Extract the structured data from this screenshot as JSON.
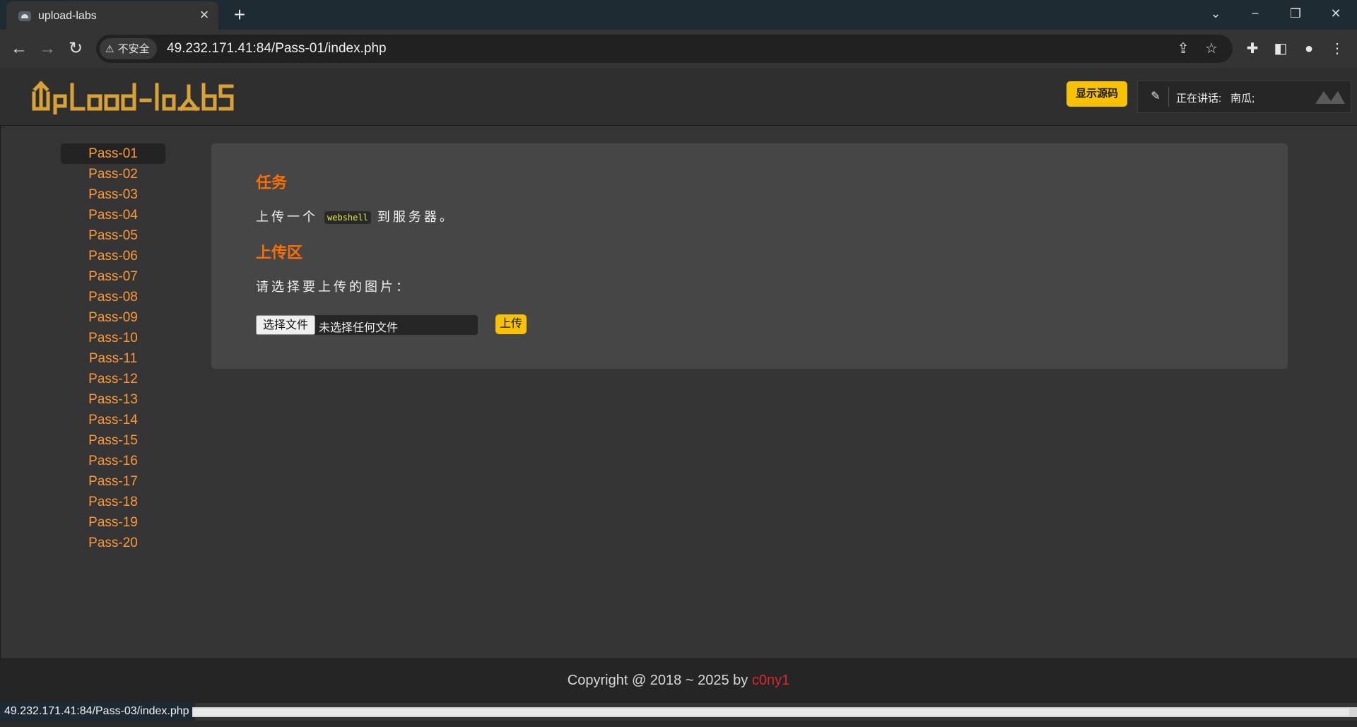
{
  "browser": {
    "tab_title": "upload-labs",
    "security_label": "不安全",
    "url": "49.232.171.41:84/Pass-01/index.php",
    "status_url": "49.232.171.41:84/Pass-03/index.php"
  },
  "header": {
    "logo_text": "Upload-labS",
    "source_button": "显示源码",
    "voice_speaking": "正在讲话:",
    "voice_speaker": "南瓜;"
  },
  "sidebar": {
    "items": [
      "Pass-01",
      "Pass-02",
      "Pass-03",
      "Pass-04",
      "Pass-05",
      "Pass-06",
      "Pass-07",
      "Pass-08",
      "Pass-09",
      "Pass-10",
      "Pass-11",
      "Pass-12",
      "Pass-13",
      "Pass-14",
      "Pass-15",
      "Pass-16",
      "Pass-17",
      "Pass-18",
      "Pass-19",
      "Pass-20"
    ],
    "active_index": 0
  },
  "task": {
    "heading": "任务",
    "text_before": "上传一个",
    "code": "webshell",
    "text_after": "到服务器。"
  },
  "upload": {
    "heading": "上传区",
    "prompt": "请选择要上传的图片：",
    "choose_label": "选择文件",
    "no_file_label": "未选择任何文件",
    "submit_label": "上传"
  },
  "footer": {
    "copyright": "Copyright @ 2018 ~ 2025 by ",
    "author": "c0ny1"
  },
  "colors": {
    "accent_orange": "#ff6f00",
    "link_orange": "#ff9a3c",
    "button_yellow": "#f8c200",
    "author_red": "#e0252e"
  }
}
